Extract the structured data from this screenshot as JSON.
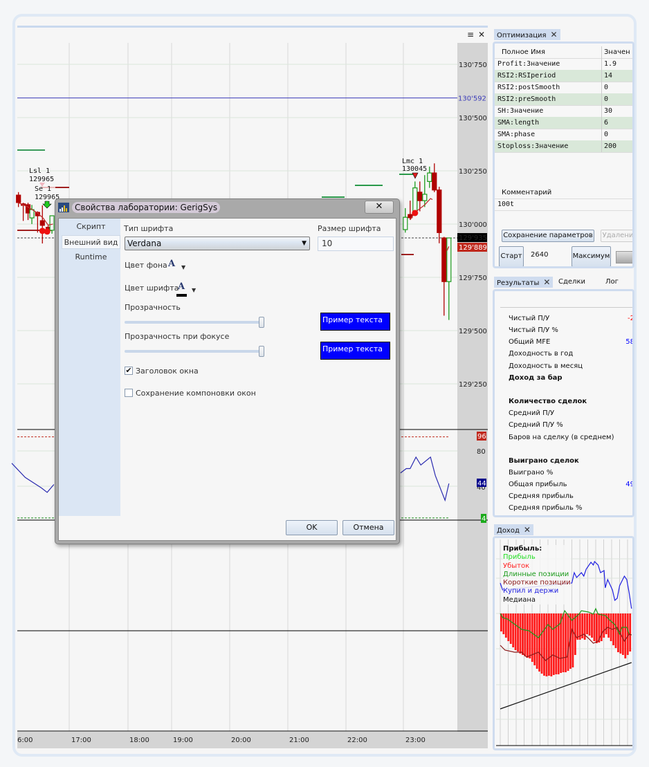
{
  "chart_panel": {
    "menu_icon": "dropdown-menu-icon",
    "close_icon": "close-icon",
    "menu_glyph": "≡",
    "close_glyph": "✕"
  },
  "price_axis": {
    "ticks": [
      "130'750",
      "130'500",
      "130'250",
      "130'000",
      "129'750",
      "129'500",
      "129'250"
    ],
    "tick_values": [
      130750,
      130500,
      130250,
      130000,
      129750,
      129500,
      129250
    ],
    "ref_line_label": "130'592",
    "ref_line_value": 130592,
    "last_price_label": "129'935",
    "last_price_value": 129935,
    "bid_price_label": "129'889",
    "bid_price_value": 129889,
    "colors": {
      "ref_line": "#3a3ab8",
      "last_bg": "#000000",
      "bid_bg": "#c0281c"
    }
  },
  "time_axis": [
    "6:00",
    "17:00",
    "18:00",
    "19:00",
    "20:00",
    "21:00",
    "22:00",
    "23:00"
  ],
  "annotations": [
    {
      "name": "Lsl 1",
      "price": "129965"
    },
    {
      "name": "Se 1",
      "price": "129965"
    },
    {
      "name": "Lmc 1",
      "price": "130045"
    }
  ],
  "chart_data": {
    "type": "candlestick",
    "candles": [
      {
        "t": "16:07",
        "o": 130136,
        "h": 130150,
        "l": 130080,
        "c": 130101
      },
      {
        "t": "16:12",
        "o": 130095,
        "h": 130100,
        "l": 130015,
        "c": 130088
      },
      {
        "t": "16:17",
        "o": 130091,
        "h": 130100,
        "l": 130019,
        "c": 130052
      },
      {
        "t": "16:21",
        "o": 130029,
        "h": 130090,
        "l": 130000,
        "c": 130068
      },
      {
        "t": "16:27",
        "o": 130055,
        "h": 130060,
        "l": 129960,
        "c": 130039
      },
      {
        "t": "16:32",
        "o": 130016,
        "h": 130088,
        "l": 129909,
        "c": 129994
      },
      {
        "t": "16:38",
        "o": 129985,
        "h": 129995,
        "l": 129955,
        "c": 129975
      },
      {
        "t": "16:42",
        "o": 129971,
        "h": 130039,
        "l": 129955,
        "c": 130039
      },
      {
        "t": "23:02",
        "o": 129974,
        "h": 130075,
        "l": 129960,
        "c": 130032
      },
      {
        "t": "23:07",
        "o": 130045,
        "h": 130110,
        "l": 130020,
        "c": 130030
      },
      {
        "t": "23:12",
        "o": 130045,
        "h": 130200,
        "l": 130040,
        "c": 130170
      },
      {
        "t": "23:17",
        "o": 130150,
        "h": 130200,
        "l": 130060,
        "c": 130110
      },
      {
        "t": "23:22",
        "o": 130110,
        "h": 130230,
        "l": 130080,
        "c": 130140
      },
      {
        "t": "23:27",
        "o": 130200,
        "h": 130270,
        "l": 130170,
        "c": 130240
      },
      {
        "t": "23:32",
        "o": 130240,
        "h": 130285,
        "l": 130150,
        "c": 130160
      },
      {
        "t": "23:37",
        "o": 130160,
        "h": 130175,
        "l": 129910,
        "c": 129960
      },
      {
        "t": "23:42",
        "o": 129935,
        "h": 129940,
        "l": 129570,
        "c": 129730
      },
      {
        "t": "23:47",
        "o": 129730,
        "h": 129935,
        "l": 129550,
        "c": 129935
      }
    ],
    "sma": [
      [
        [
          "16:07",
          130100
        ],
        [
          "16:17",
          130080
        ],
        [
          "16:27",
          130052
        ],
        [
          "16:33",
          130027
        ],
        [
          "16:38",
          129995
        ],
        [
          "16:43",
          130000
        ]
      ],
      [
        [
          "23:07",
          130020
        ],
        [
          "23:12",
          130055
        ],
        [
          "23:22",
          130090
        ],
        [
          "23:28",
          130120
        ],
        [
          "23:30",
          130115
        ]
      ],
      [
        [
          "23:45",
          129875
        ],
        [
          "23:47",
          129895
        ]
      ]
    ],
    "entry_markers": [
      [
        "16:32",
        129968
      ],
      [
        "16:37",
        129965
      ],
      [
        "23:12",
        130052
      ]
    ],
    "rsi": {
      "levels": {
        "upper": 96,
        "lower": 4
      },
      "labels": [
        "96",
        "80",
        "44",
        "40",
        "4"
      ],
      "segments": [
        [
          [
            "16:00",
            66
          ],
          [
            "16:14",
            50
          ],
          [
            "16:31",
            38
          ],
          [
            "16:37",
            33
          ],
          [
            "16:44",
            42
          ]
        ],
        [
          [
            "22:57",
            55
          ],
          [
            "23:03",
            60
          ],
          [
            "23:07",
            60
          ],
          [
            "23:13",
            73
          ],
          [
            "23:18",
            64
          ],
          [
            "23:28",
            73
          ],
          [
            "23:33",
            52
          ],
          [
            "23:43",
            24
          ],
          [
            "23:47",
            43
          ]
        ]
      ],
      "colors": {
        "line": "#2b2bb0",
        "upper": "#c0281c",
        "lower": "#1a8a1a"
      }
    }
  },
  "optimization": {
    "tab_label": "Оптимизация",
    "columns": [
      "Полное Имя",
      "Значен"
    ],
    "rows": [
      [
        "Profit:Значение",
        "1.9"
      ],
      [
        "RSI2:RSIperiod",
        "14"
      ],
      [
        "RSI2:postSmooth",
        "0"
      ],
      [
        "RSI2:preSmooth",
        "0"
      ],
      [
        "SH:Значение",
        "30"
      ],
      [
        "SMA:length",
        "6"
      ],
      [
        "SMA:phase",
        "0"
      ],
      [
        "Stoploss:Значение",
        "200"
      ]
    ],
    "comment_header": "Комментарий",
    "comment_value": "100t",
    "save_button": "Сохранение параметров",
    "delete_button": "Удалени",
    "start_button": "Старт",
    "count_value": "2640",
    "max_button": "Максимум"
  },
  "results": {
    "tabs": [
      "Результаты",
      "Сделки",
      "Лог"
    ],
    "rows": [
      {
        "label": "Чистый П/У",
        "value": "-2",
        "color": "#ff0000"
      },
      {
        "label": "Чистый П/У %",
        "value": ""
      },
      {
        "label": "Общий MFE",
        "value": "58",
        "color": "#0000ff"
      },
      {
        "label": "Доходность в год",
        "value": ""
      },
      {
        "label": "Доходность в месяц",
        "value": ""
      },
      {
        "label": "Доход за бар",
        "value": "",
        "bold": true
      },
      {
        "label": "Количество сделок",
        "value": "",
        "bold": true
      },
      {
        "label": "Средний П/У",
        "value": ""
      },
      {
        "label": "Средний П/У %",
        "value": ""
      },
      {
        "label": "Баров на сделку (в среднем)",
        "value": ""
      },
      {
        "label": "Выиграно сделок",
        "value": "",
        "bold": true
      },
      {
        "label": "Выиграно %",
        "value": ""
      },
      {
        "label": "Общая прибыль",
        "value": "49",
        "color": "#0000ff"
      },
      {
        "label": "Средняя прибыль",
        "value": ""
      },
      {
        "label": "Средняя прибыль %",
        "value": ""
      }
    ]
  },
  "income": {
    "tab_label": "Доход",
    "legend_title": "Прибыль:",
    "legend": [
      {
        "label": "Прибыль",
        "color": "#22dd22"
      },
      {
        "label": "Убыток",
        "color": "#ff2020"
      },
      {
        "label": "Длинные позиции",
        "color": "#1a9a1a"
      },
      {
        "label": "Короткие позиции",
        "color": "#8b1a1a"
      },
      {
        "label": "Купил и держи",
        "color": "#2020e0"
      },
      {
        "label": "Медиана",
        "color": "#111111"
      }
    ],
    "loss_bars": [
      -26,
      -30,
      -35,
      -40,
      -44,
      -49,
      -53,
      -55,
      -58,
      -60,
      -62,
      -64,
      -65,
      -70,
      -75,
      -80,
      -84,
      -87,
      -90,
      -91,
      -90,
      -91,
      -89,
      -88,
      -88,
      -86,
      -85,
      -85,
      -83,
      -80,
      -78,
      -60,
      -38,
      -38,
      -36,
      -38,
      -30,
      -32,
      -35,
      -40,
      -43,
      -42,
      -40,
      -35,
      -30,
      -35,
      -40,
      -46,
      -50,
      -56,
      -58,
      -60,
      -65,
      -60,
      -55
    ],
    "buy_hold": [
      [
        0,
        44
      ],
      [
        1,
        34
      ],
      [
        30,
        44
      ],
      [
        31,
        59
      ],
      [
        32,
        52
      ],
      [
        34,
        59
      ],
      [
        35,
        54
      ],
      [
        36,
        64
      ],
      [
        38,
        74
      ],
      [
        39,
        70
      ],
      [
        39.5,
        75
      ],
      [
        41,
        70
      ],
      [
        42,
        59
      ],
      [
        43.5,
        62
      ],
      [
        44,
        37
      ],
      [
        45,
        49
      ],
      [
        47,
        34
      ],
      [
        48,
        19
      ],
      [
        49,
        22
      ],
      [
        50,
        40
      ],
      [
        52,
        54
      ],
      [
        53,
        49
      ],
      [
        54,
        30
      ],
      [
        55,
        7
      ]
    ],
    "long": [
      [
        0,
        0
      ],
      [
        1,
        -6
      ],
      [
        3,
        -8
      ],
      [
        5,
        -13
      ],
      [
        9,
        -23
      ],
      [
        12,
        -25
      ],
      [
        16,
        -35
      ],
      [
        20,
        -16
      ],
      [
        22,
        -23
      ],
      [
        25,
        -15
      ],
      [
        27,
        4
      ],
      [
        30,
        -10
      ],
      [
        33,
        -1
      ],
      [
        34,
        4
      ],
      [
        37,
        2
      ],
      [
        39,
        -1
      ],
      [
        40,
        7
      ],
      [
        41,
        -1
      ],
      [
        44,
        -3
      ],
      [
        46,
        -10
      ],
      [
        48,
        -16
      ],
      [
        50,
        -30
      ],
      [
        51,
        -20
      ],
      [
        53,
        -20
      ],
      [
        54,
        -30
      ],
      [
        55,
        -31
      ]
    ],
    "short": [
      [
        0,
        -46
      ],
      [
        2,
        -53
      ],
      [
        6,
        -56
      ],
      [
        9,
        -56
      ],
      [
        11,
        -63
      ],
      [
        16,
        -56
      ],
      [
        19,
        -68
      ],
      [
        22,
        -60
      ],
      [
        25,
        -65
      ],
      [
        28,
        -63
      ],
      [
        30,
        -23
      ],
      [
        32,
        -35
      ],
      [
        35,
        -30
      ],
      [
        37,
        -36
      ],
      [
        39,
        -43
      ],
      [
        41,
        -40
      ],
      [
        43,
        -26
      ],
      [
        45,
        -20
      ],
      [
        47,
        -23
      ],
      [
        49,
        -20
      ],
      [
        52,
        -40
      ],
      [
        54,
        -30
      ],
      [
        55,
        -31
      ]
    ],
    "median": [
      [
        0,
        -138
      ],
      [
        55,
        -71
      ]
    ]
  },
  "dialog": {
    "title": "Свойства лаборатории: GerigSys",
    "close_glyph": "✕",
    "nav": [
      "Скрипт",
      "Внешний вид",
      "Runtime"
    ],
    "selected_nav": "Внешний вид",
    "font_type_label": "Тип шрифта",
    "font_type_value": "Verdana",
    "font_size_label": "Размер шрифта",
    "font_size_value": "10",
    "bg_color_label": "Цвет фона",
    "font_color_label": "Цвет шрифта",
    "font_glyph": "A",
    "opacity_label": "Прозрачность",
    "opacity_value": 1.0,
    "focus_opacity_label": "Прозрачность при фокусе",
    "focus_opacity_value": 1.0,
    "sample_text": "Пример текста",
    "sample_bg": "#0000ff",
    "window_title_label": "Заголовок окна",
    "window_title_checked": true,
    "save_layout_label": "Сохранение компоновки окон",
    "save_layout_checked": false,
    "ok_button": "OK",
    "cancel_button": "Отмена"
  }
}
